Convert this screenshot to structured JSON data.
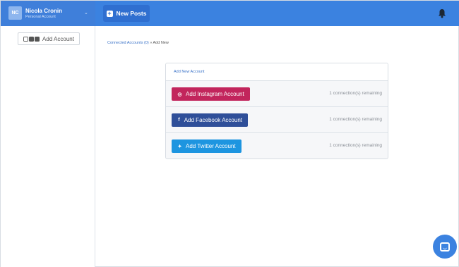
{
  "account": {
    "initials": "NC",
    "name": "Nicola Cronin",
    "type": "Personal Account",
    "caret": "⌄"
  },
  "toolbar": {
    "new_posts_label": "New Posts",
    "new_posts_icon": "plus-square-icon"
  },
  "header": {
    "bell_icon": "bell-icon"
  },
  "sidebar": {
    "add_account_label": "Add Account",
    "icons": [
      "instagram-icon",
      "facebook-icon",
      "twitter-icon"
    ]
  },
  "breadcrumb": {
    "link": "Connected Accounts (0)",
    "separator": " » ",
    "current": "Add New"
  },
  "card": {
    "title": "Add New Account",
    "rows": [
      {
        "icon": "instagram-icon",
        "glyph": "◎",
        "label": "Add Instagram Account",
        "remaining": "1 connection(s) remaining",
        "color": "#c2255c"
      },
      {
        "icon": "facebook-icon",
        "glyph": "f",
        "label": "Add Facebook Account",
        "remaining": "1 connection(s) remaining",
        "color": "#2f4f99"
      },
      {
        "icon": "twitter-icon",
        "glyph": "✦",
        "label": "Add Twitter Account",
        "remaining": "1 connection(s) remaining",
        "color": "#1d95e0"
      }
    ]
  },
  "colors": {
    "topbar": "#3b82e0",
    "accent": "#2f6fd0",
    "instagram": "#c2255c",
    "facebook": "#2f4f99",
    "twitter": "#1d95e0"
  },
  "chat": {
    "icon": "chat-icon"
  }
}
